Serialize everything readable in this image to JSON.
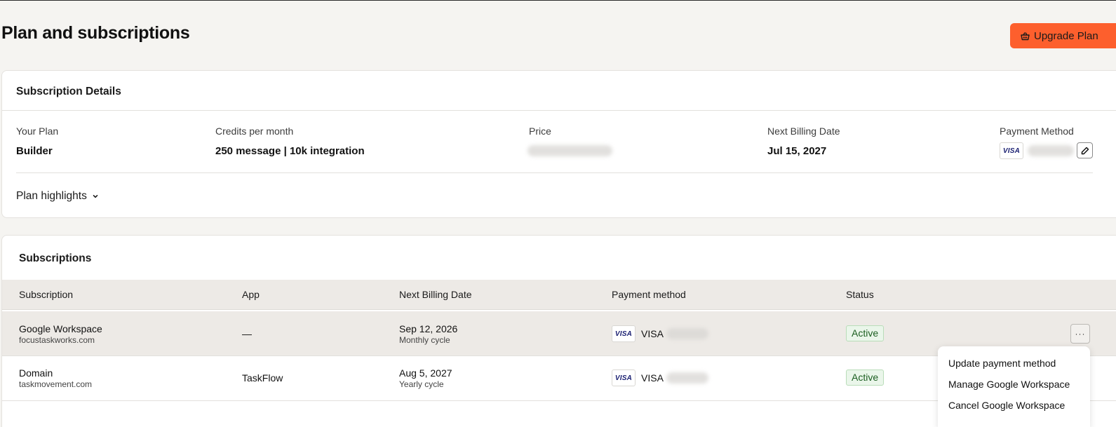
{
  "header": {
    "title": "Plan and subscriptions",
    "upgrade_label": "Upgrade Plan"
  },
  "details": {
    "title": "Subscription Details",
    "plan_label": "Your Plan",
    "plan_value": "Builder",
    "credits_label": "Credits per month",
    "credits_value": "250 message | 10k integration",
    "price_label": "Price",
    "next_billing_label": "Next Billing Date",
    "next_billing_value": "Jul 15, 2027",
    "payment_label": "Payment Method",
    "card_brand": "VISA",
    "highlights_label": "Plan highlights"
  },
  "subscriptions": {
    "title": "Subscriptions",
    "columns": {
      "subscription": "Subscription",
      "app": "App",
      "next_billing": "Next Billing Date",
      "payment": "Payment method",
      "status": "Status"
    },
    "rows": [
      {
        "name": "Google Workspace",
        "domain": "focustaskworks.com",
        "app": "—",
        "date": "Sep 12, 2026",
        "cycle": "Monthly cycle",
        "card_badge": "VISA",
        "card_name": "VISA",
        "status": "Active"
      },
      {
        "name": "Domain",
        "domain": "taskmovement.com",
        "app": "TaskFlow",
        "date": "Aug 5, 2027",
        "cycle": "Yearly cycle",
        "card_badge": "VISA",
        "card_name": "VISA",
        "status": "Active"
      }
    ],
    "more_label": "···"
  },
  "context_menu": {
    "items": [
      "Update payment method",
      "Manage Google Workspace",
      "Cancel Google Workspace"
    ]
  },
  "colors": {
    "accent": "#fd5f2d",
    "status_bg": "#eaf6ea",
    "status_text": "#1b5e20",
    "visa": "#1a1f71"
  }
}
